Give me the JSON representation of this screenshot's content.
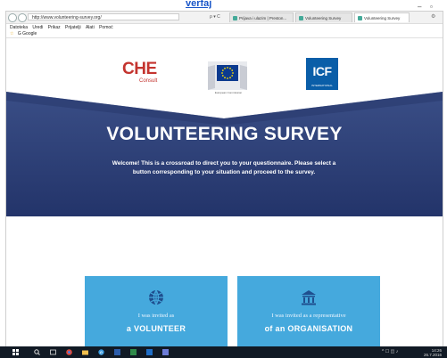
{
  "caption": {
    "link_text": "verfaj"
  },
  "browser": {
    "url": "http://www.volunteering-survey.org/",
    "url_controls": "ρ ▾ C",
    "tabs": [
      {
        "label": "Prijava i ulazim | Preston..."
      },
      {
        "label": "Volunteering Survey"
      },
      {
        "label": "Volunteering Survey"
      }
    ],
    "menu": [
      "Datoteka",
      "Uredi",
      "Prikaz",
      "Prijatelji",
      "Alati",
      "Pomoć"
    ],
    "favorites": [
      "☆",
      "G Google"
    ]
  },
  "page": {
    "che_logo": "CHE",
    "che_sub": "Consult",
    "eu_caption": "European Commission",
    "icf_logo": "ICF",
    "icf_sub": "INTERNATIONAL",
    "title": "VOLUNTEERING SURVEY",
    "intro": "Welcome! This is a crossroad to direct you to your questionnaire. Please select a button corresponding to your situation and proceed to the survey.",
    "cards": [
      {
        "small": "I was invited as",
        "big": "a VOLUNTEER",
        "icon": "globe-icon"
      },
      {
        "small": "I was invited as a representative",
        "big": "of an ORGANISATION",
        "icon": "building-icon"
      }
    ]
  },
  "taskbar": {
    "time": "14:26",
    "date": "26.7.2016"
  },
  "colors": {
    "hero": "#2c3f72",
    "card": "#45a9dd",
    "che": "#c4342f",
    "icf": "#0a5ea8",
    "eu": "#0b3a8f",
    "taskbar": "#111a25"
  }
}
